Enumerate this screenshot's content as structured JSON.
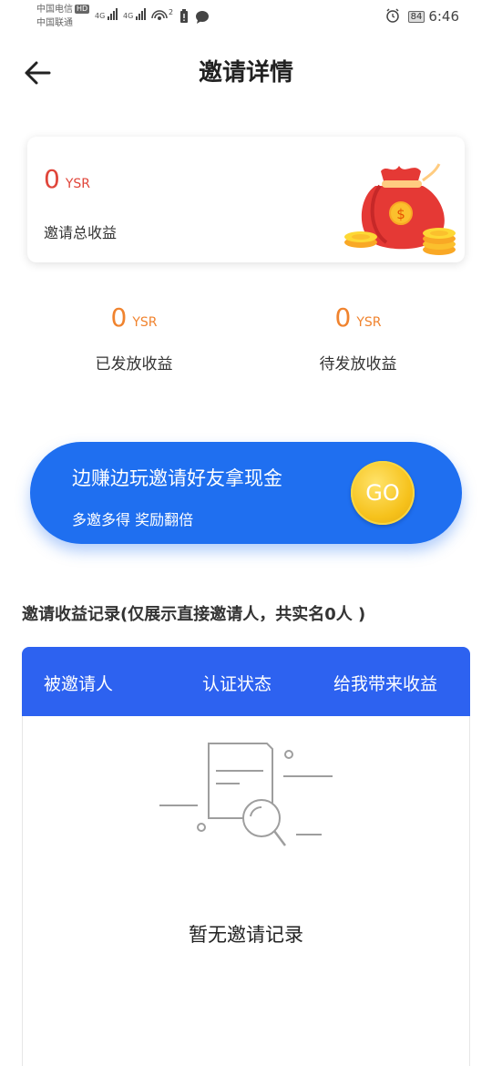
{
  "status_bar": {
    "carrier_1": "中国电信",
    "hd": "HD",
    "carrier_2": "中国联通",
    "net_1": "4G",
    "net_2": "4G",
    "hotspot_count": "2",
    "battery": "84",
    "time": "6:46"
  },
  "header": {
    "title": "邀请详情"
  },
  "total": {
    "amount": "0",
    "unit": "YSR",
    "label": "邀请总收益"
  },
  "stats": {
    "issued": {
      "amount": "0",
      "unit": "YSR",
      "label": "已发放收益"
    },
    "pending": {
      "amount": "0",
      "unit": "YSR",
      "label": "待发放收益"
    }
  },
  "banner": {
    "title": "边赚边玩邀请好友拿现金",
    "subtitle": "多邀多得 奖励翻倍",
    "go_label": "GO"
  },
  "records": {
    "title": "邀请收益记录(仅展示直接邀请人，共实名0人 )",
    "columns": [
      "被邀请人",
      "认证状态",
      "给我带来收益"
    ],
    "empty_text": "暂无邀请记录"
  },
  "colors": {
    "accent_red": "#e0453a",
    "accent_orange": "#f0832e",
    "banner_blue": "#1f6ff0",
    "table_header_blue": "#2d62f0",
    "gold": "#f6c21c"
  }
}
